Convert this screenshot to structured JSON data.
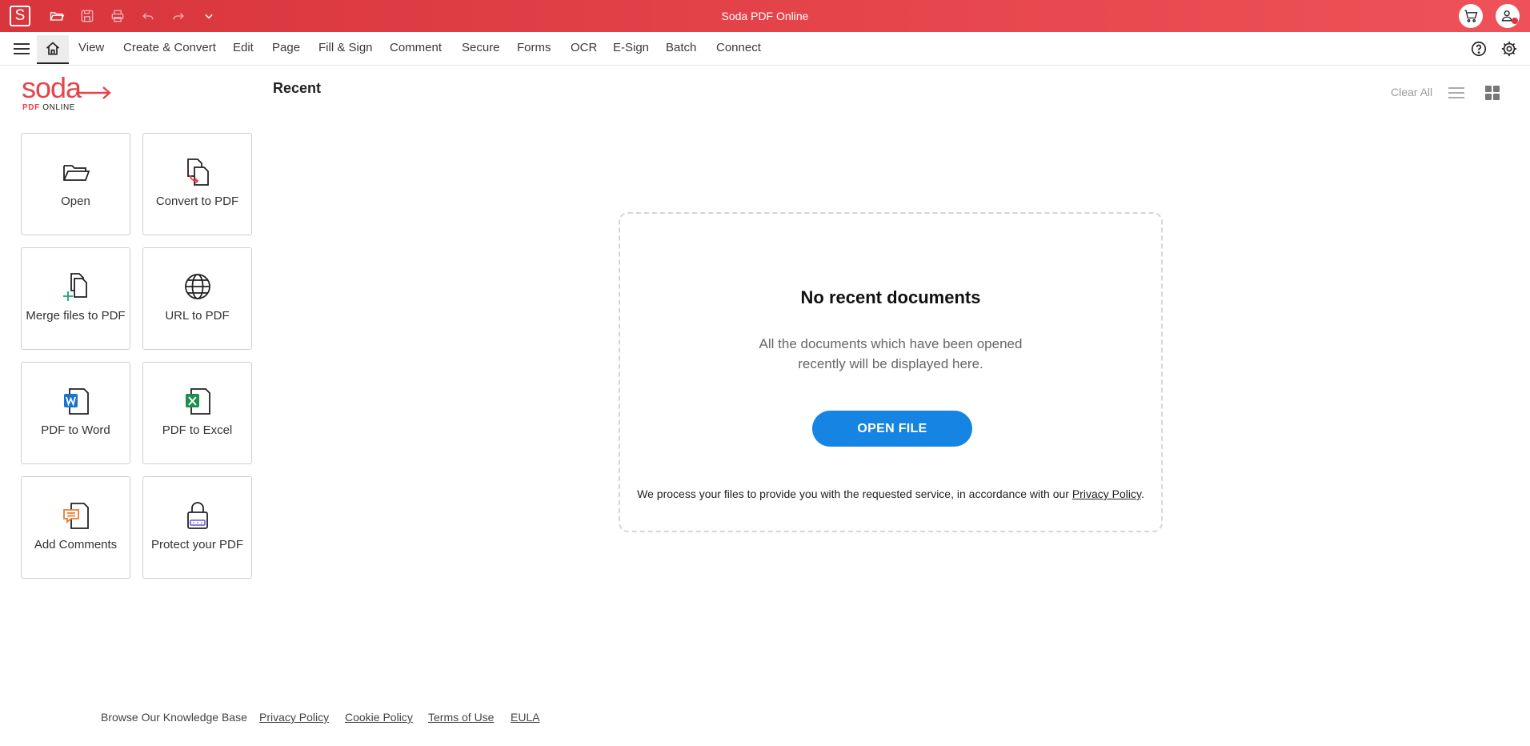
{
  "app": {
    "badge": "S",
    "title": "Soda PDF Online"
  },
  "quick_access": [
    {
      "name": "open-folder-icon"
    },
    {
      "name": "save-icon"
    },
    {
      "name": "print-icon"
    },
    {
      "name": "undo-icon"
    },
    {
      "name": "redo-icon"
    },
    {
      "name": "chevron-down-icon"
    }
  ],
  "menu": {
    "items": [
      "View",
      "Create & Convert",
      "Edit",
      "Page",
      "Fill & Sign",
      "Comment",
      "Secure",
      "Forms",
      "OCR",
      "E-Sign",
      "Batch",
      "Connect"
    ]
  },
  "logo": {
    "word": "soda",
    "sub_pdf": "PDF",
    "sub_online": "ONLINE"
  },
  "tiles": [
    {
      "label": "Open",
      "icon": "folder-icon"
    },
    {
      "label": "Convert to PDF",
      "icon": "convert-icon"
    },
    {
      "label": "Merge files to PDF",
      "icon": "merge-icon"
    },
    {
      "label": "URL to PDF",
      "icon": "globe-icon"
    },
    {
      "label": "PDF to Word",
      "icon": "word-icon"
    },
    {
      "label": "PDF to Excel",
      "icon": "excel-icon"
    },
    {
      "label": "Add Comments",
      "icon": "comment-icon"
    },
    {
      "label": "Protect your PDF",
      "icon": "lock-icon"
    }
  ],
  "recent": {
    "heading": "Recent",
    "clear_all": "Clear All",
    "empty_title": "No recent documents",
    "empty_desc": "All the documents which have been opened recently will be displayed here.",
    "open_file": "OPEN FILE",
    "privacy_prefix": "We process your files to provide you with the requested service, in accordance with our ",
    "privacy_link": "Privacy Policy",
    "privacy_suffix": "."
  },
  "footer": {
    "knowledge_base": "Browse Our Knowledge Base",
    "links": [
      "Privacy Policy",
      "Cookie Policy",
      "Terms of Use",
      "EULA"
    ]
  },
  "colors": {
    "brand_red": "#e5444b",
    "primary_blue": "#1684e2",
    "word_blue": "#1b73d1",
    "excel_green": "#1e8e4a"
  }
}
